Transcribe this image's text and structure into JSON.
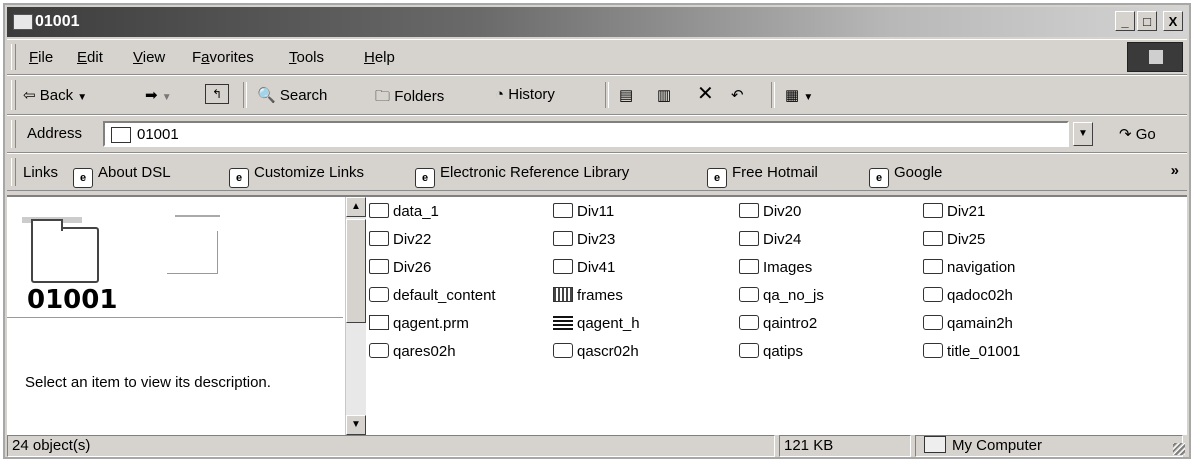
{
  "window": {
    "title": "01001",
    "min": "_",
    "max": "□",
    "close": "X"
  },
  "menu": {
    "items": [
      {
        "label": "File",
        "u": "F",
        "rest": "ile"
      },
      {
        "label": "Edit",
        "u": "E",
        "rest": "dit"
      },
      {
        "label": "View",
        "u": "V",
        "rest": "iew"
      },
      {
        "label": "Favorites",
        "pre": "F",
        "u": "a",
        "rest": "vorites"
      },
      {
        "label": "Tools",
        "u": "T",
        "rest": "ools"
      },
      {
        "label": "Help",
        "u": "H",
        "rest": "elp"
      }
    ]
  },
  "toolbar": {
    "back": "Back",
    "search": "Search",
    "folders": "Folders",
    "history": "History"
  },
  "address": {
    "label": "Address",
    "value": "01001",
    "go": "Go"
  },
  "links": {
    "label": "Links",
    "items": [
      "About DSL",
      "Customize Links",
      "Electronic Reference Library",
      "Free Hotmail",
      "Google"
    ]
  },
  "left_pane": {
    "folder_name": "01001",
    "description": "Select an item to view its description."
  },
  "files": [
    {
      "name": "data_1",
      "type": "folder"
    },
    {
      "name": "Div11",
      "type": "folder"
    },
    {
      "name": "Div20",
      "type": "folder"
    },
    {
      "name": "Div21",
      "type": "folder"
    },
    {
      "name": "Div22",
      "type": "folder"
    },
    {
      "name": "Div23",
      "type": "folder"
    },
    {
      "name": "Div24",
      "type": "folder"
    },
    {
      "name": "Div25",
      "type": "folder"
    },
    {
      "name": "Div26",
      "type": "folder"
    },
    {
      "name": "Div41",
      "type": "folder"
    },
    {
      "name": "Images",
      "type": "folder"
    },
    {
      "name": "navigation",
      "type": "folder"
    },
    {
      "name": "default_content",
      "type": "html"
    },
    {
      "name": "frames",
      "type": "frames"
    },
    {
      "name": "qa_no_js",
      "type": "html"
    },
    {
      "name": "qadoc02h",
      "type": "html"
    },
    {
      "name": "qagent.prm",
      "type": "prm"
    },
    {
      "name": "qagent_h",
      "type": "h"
    },
    {
      "name": "qaintro2",
      "type": "html"
    },
    {
      "name": "qamain2h",
      "type": "html"
    },
    {
      "name": "qares02h",
      "type": "html"
    },
    {
      "name": "qascr02h",
      "type": "html"
    },
    {
      "name": "qatips",
      "type": "html"
    },
    {
      "name": "title_01001",
      "type": "html"
    }
  ],
  "status": {
    "objects": "24 object(s)",
    "size": "121 KB",
    "zone": "My Computer"
  }
}
